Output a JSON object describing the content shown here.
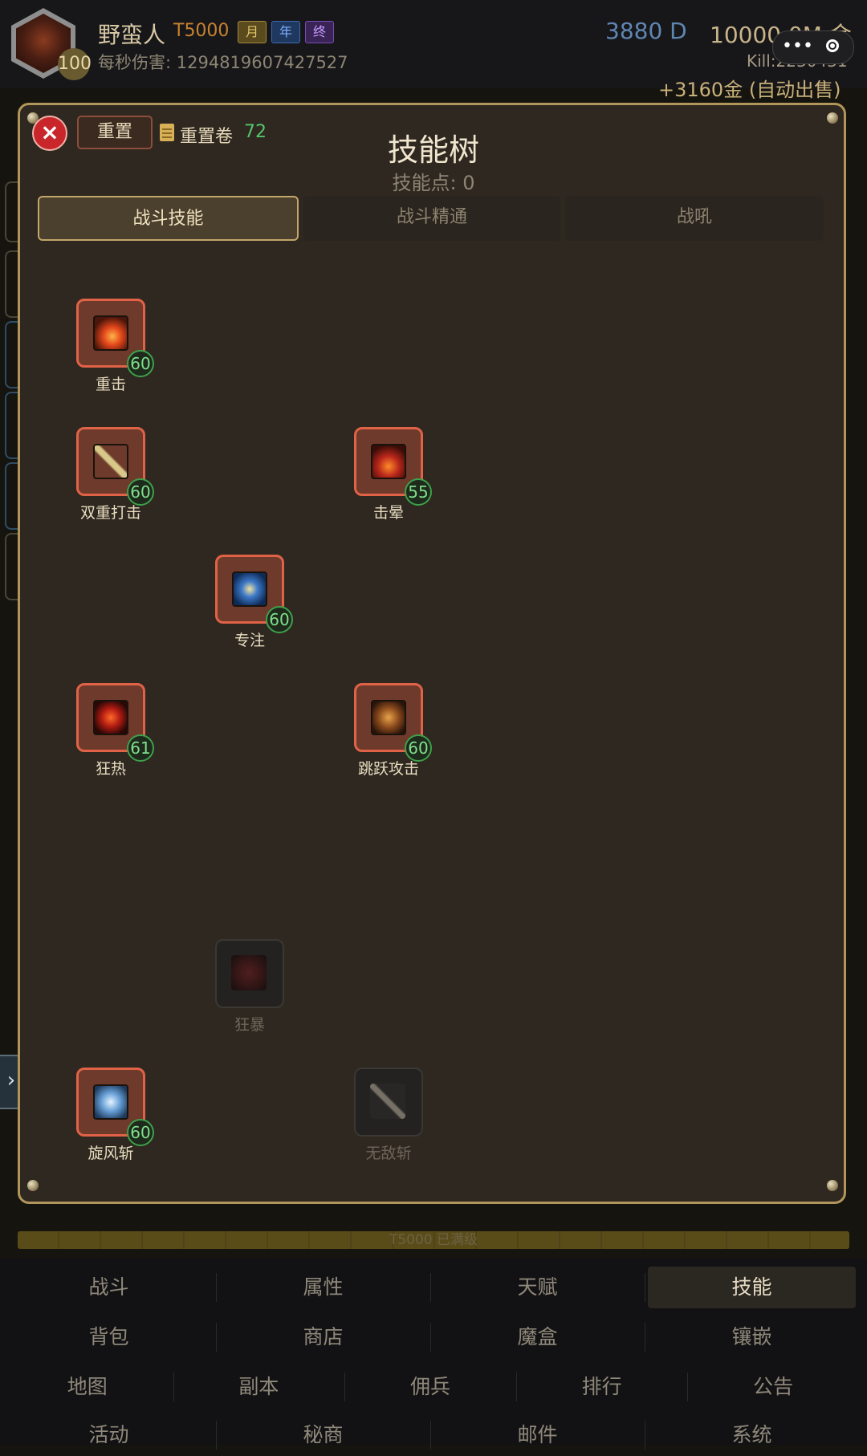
{
  "header": {
    "player_name": "野蛮人",
    "tier": "T5000",
    "tags": [
      "月",
      "年",
      "终"
    ],
    "level": "100",
    "dps_label": "每秒伤害: 1294819607427527",
    "currency_d": "3880 D",
    "currency_gold": "10000.0M 金",
    "kill_count": "Kill:2230431",
    "reward_text": "+3160金 (自动出售)"
  },
  "panel": {
    "close_icon": "×",
    "reset_label": "重置",
    "scroll_label": "重置卷",
    "scroll_count": "72",
    "title": "技能树",
    "skill_points": "技能点: 0",
    "tabs": [
      "战斗技能",
      "战斗精通",
      "战吼"
    ]
  },
  "skills": [
    {
      "name": "重击",
      "level": "60",
      "locked": false,
      "icon": "heavy-strike-icon",
      "col": 0,
      "row": 0
    },
    {
      "name": "双重打击",
      "level": "60",
      "locked": false,
      "icon": "double-swords-icon",
      "col": 0,
      "row": 1
    },
    {
      "name": "击晕",
      "level": "55",
      "locked": false,
      "icon": "stun-icon",
      "col": 2,
      "row": 1
    },
    {
      "name": "专注",
      "level": "60",
      "locked": false,
      "icon": "focus-icon",
      "col": 1,
      "row": 2
    },
    {
      "name": "狂热",
      "level": "61",
      "locked": false,
      "icon": "frenzy-icon",
      "col": 0,
      "row": 3
    },
    {
      "name": "跳跃攻击",
      "level": "60",
      "locked": false,
      "icon": "leap-attack-icon",
      "col": 2,
      "row": 3
    },
    {
      "name": "狂暴",
      "level": "",
      "locked": true,
      "icon": "berserk-icon",
      "col": 1,
      "row": 5
    },
    {
      "name": "旋风斩",
      "level": "60",
      "locked": false,
      "icon": "whirlwind-icon",
      "col": 0,
      "row": 6
    },
    {
      "name": "无敌斩",
      "level": "",
      "locked": true,
      "icon": "invincible-slash-icon",
      "col": 2,
      "row": 6
    }
  ],
  "progress": {
    "label": "T5000 已满级",
    "fraction": 1.0
  },
  "nav": [
    [
      "战斗",
      "属性",
      "天赋",
      "技能"
    ],
    [
      "背包",
      "商店",
      "魔盒",
      "镶嵌"
    ],
    [
      "地图",
      "副本",
      "佣兵",
      "排行",
      "公告"
    ],
    [
      "活动",
      "秘商",
      "邮件",
      "系统"
    ]
  ],
  "nav_active": "技能",
  "colors": {
    "accent_gold": "#b2955a",
    "skill_frame": "#e06247",
    "level_badge": "#3ea04b",
    "close_red": "#c8262a"
  }
}
